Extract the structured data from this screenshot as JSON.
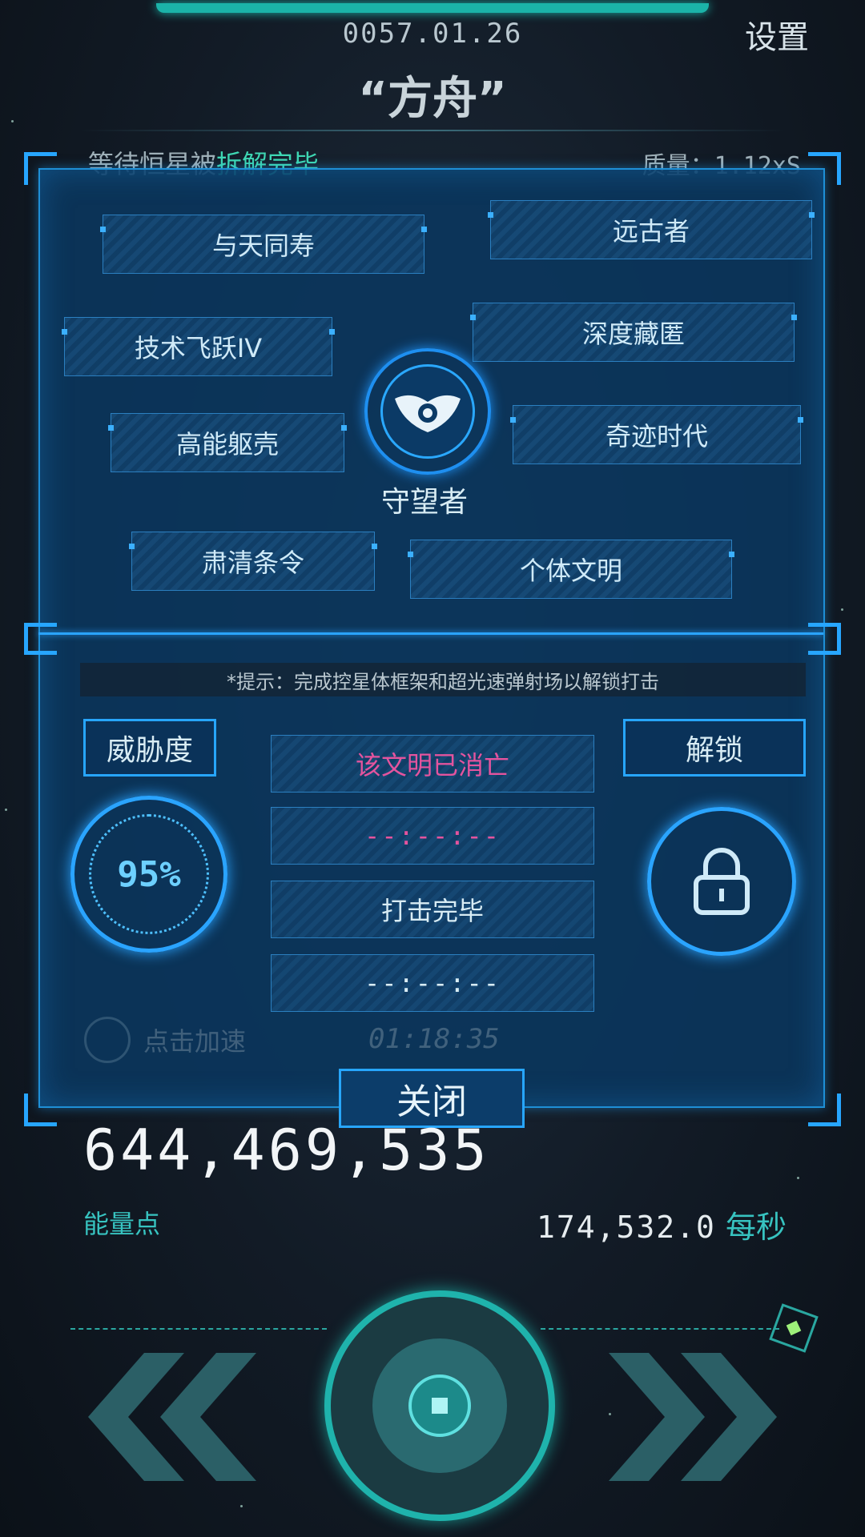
{
  "header": {
    "date": "0057.01.26",
    "settings_label": "设置",
    "ship_name": "“方舟”",
    "status_prefix": "等待恒星被",
    "status_highlight": "拆解完毕",
    "mass_label": "质量：1.12xS"
  },
  "tech_nodes": {
    "n1": "与天同寿",
    "n2": "远古者",
    "n3": "技术飞跃IV",
    "n4": "深度藏匿",
    "n5": "高能躯壳",
    "n6": "奇迹时代",
    "n7": "肃清条令",
    "n8": "个体文明"
  },
  "center": {
    "name": "守望者"
  },
  "hint": "*提示：完成控星体框架和超光速弹射场以解锁打击",
  "threat": {
    "label": "威胁度",
    "value": "95%"
  },
  "unlock": {
    "label": "解锁"
  },
  "slots": {
    "s1": "该文明已消亡",
    "s2": "--:--:--",
    "s3": "打击完毕",
    "s4": "--:--:--"
  },
  "background_controls": {
    "speedup_label": "点击加速",
    "timer": "01:18:35"
  },
  "close_label": "关闭",
  "stats": {
    "energy_value": "644,469,535",
    "energy_label": "能量点",
    "rate_value": "174,532.0",
    "rate_unit": "每秒"
  },
  "colors": {
    "accent_blue": "#27a6ff",
    "accent_teal": "#37c3c0",
    "extinct_pink": "#e4549e"
  }
}
